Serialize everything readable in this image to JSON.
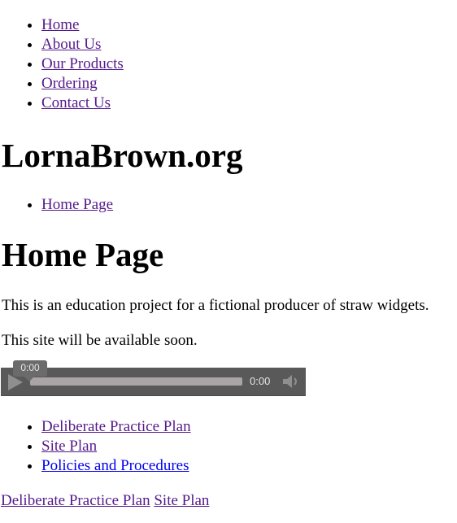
{
  "top_nav": {
    "items": [
      {
        "label": "Home",
        "state": "visited"
      },
      {
        "label": "About Us",
        "state": "visited"
      },
      {
        "label": "Our Products",
        "state": "visited"
      },
      {
        "label": "Ordering",
        "state": "visited"
      },
      {
        "label": "Contact Us",
        "state": "visited"
      }
    ]
  },
  "site_title": "LornaBrown.org",
  "breadcrumb": {
    "items": [
      {
        "label": "Home Page",
        "state": "visited"
      }
    ]
  },
  "page_title": "Home Page",
  "paragraphs": [
    "This is an education project for a fictional producer of straw widgets.",
    "This site will be available soon."
  ],
  "audio_player": {
    "current_time_tooltip": "0:00",
    "duration": "0:00",
    "progress": 0,
    "icons": {
      "play": "play-icon",
      "volume": "volume-icon"
    }
  },
  "secondary_nav": {
    "items": [
      {
        "label": "Deliberate Practice Plan",
        "state": "visited"
      },
      {
        "label": "Site Plan",
        "state": "visited"
      },
      {
        "label": "Policies and Procedures",
        "state": "unvisited"
      }
    ]
  },
  "footer_links": [
    {
      "label": "Deliberate Practice Plan",
      "state": "visited"
    },
    {
      "label": "Site Plan",
      "state": "visited"
    }
  ],
  "colors": {
    "visited_link": "#551a8b",
    "unvisited_link": "#0000ee",
    "player_bg": "#595959",
    "track": "#aaa4a6"
  }
}
